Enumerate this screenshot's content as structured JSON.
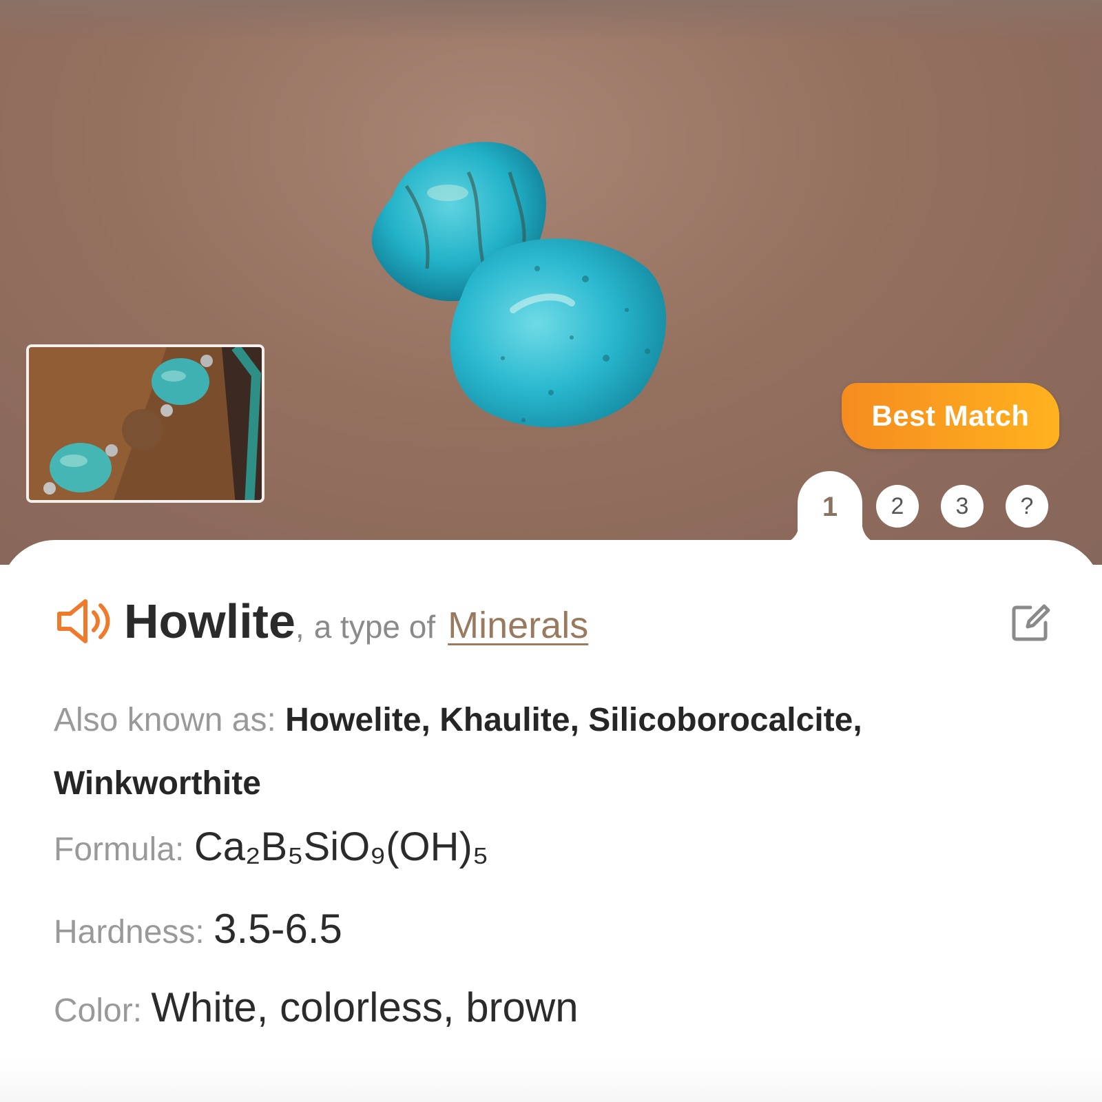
{
  "hero": {
    "photo": "turquoise-tumbled-stones",
    "thumbnail": "user-uploaded-bracelet-photo"
  },
  "badge": {
    "label": "Best Match",
    "color": "#f7941d"
  },
  "tabs": [
    {
      "label": "1",
      "active": true
    },
    {
      "label": "2",
      "active": false
    },
    {
      "label": "3",
      "active": false
    },
    {
      "label": "?",
      "active": false
    }
  ],
  "result": {
    "name": "Howlite",
    "type_prefix": "a type of",
    "category": "Minerals",
    "speaker_icon": "speaker-icon",
    "edit_icon": "edit-icon",
    "accent_color": "#f07a2b"
  },
  "facts": {
    "aka_label": "Also known as:",
    "aka_value": "Howelite, Khaulite, Silicoborocalcite, Winkworthite",
    "formula_label": "Formula:",
    "formula_value": "Ca₂B₅SiO₉(OH)₅",
    "hardness_label": "Hardness:",
    "hardness_value": "3.5-6.5",
    "color_label": "Color:",
    "color_value": "White, colorless, brown"
  }
}
